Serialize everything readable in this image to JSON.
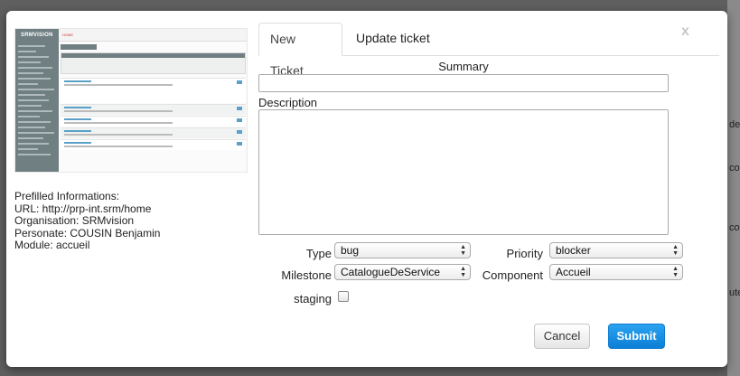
{
  "backdrop": {
    "right_fragments": [
      "de",
      "cor",
      "ute",
      "con"
    ]
  },
  "modal": {
    "close_label": "x"
  },
  "thumbnail": {
    "logo": "SRMVISION",
    "home_label": "HOME"
  },
  "prefilled": {
    "heading": "Prefilled Informations:",
    "url": "URL: http://prp-int.srm/home",
    "organisation": "Organisation: SRMvision",
    "personate": "Personate: COUSIN Benjamin",
    "module": "Module: accueil"
  },
  "tabs": [
    {
      "label": "New Ticket",
      "active": true
    },
    {
      "label": "Update ticket",
      "active": false
    }
  ],
  "form": {
    "summary_label": "Summary",
    "summary_value": "",
    "description_label": "Description",
    "description_value": "",
    "type_label": "Type",
    "type_value": "bug",
    "priority_label": "Priority",
    "priority_value": "blocker",
    "milestone_label": "Milestone",
    "milestone_value": "CatalogueDeService",
    "component_label": "Component",
    "component_value": "Accueil",
    "staging_label": "staging",
    "staging_checked": false
  },
  "buttons": {
    "cancel": "Cancel",
    "submit": "Submit"
  }
}
